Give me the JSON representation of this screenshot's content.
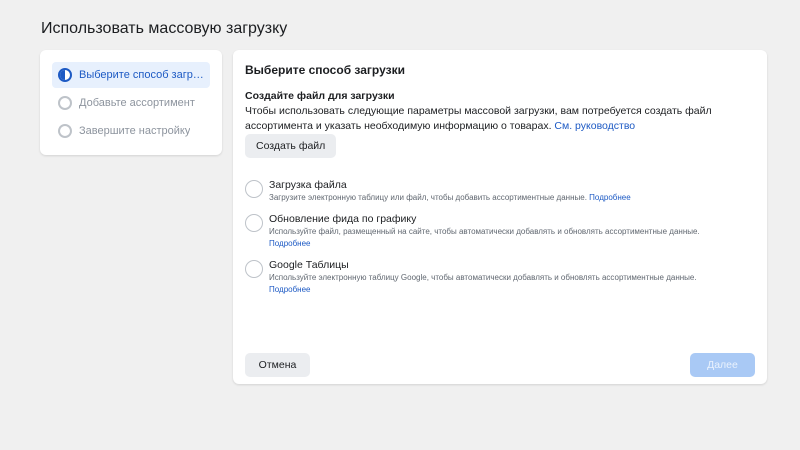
{
  "page": {
    "title": "Использовать массовую загрузку"
  },
  "steps": [
    {
      "label": "Выберите способ загрузки",
      "state": "active"
    },
    {
      "label": "Добавьте ассортимент",
      "state": "pending"
    },
    {
      "label": "Завершите настройку",
      "state": "pending"
    }
  ],
  "main": {
    "heading": "Выберите способ загрузки",
    "create_section": {
      "title": "Создайте файл для загрузки",
      "description": "Чтобы использовать следующие параметры массовой загрузки, вам потребуется создать файл ассортимента и указать необходимую информацию о товарах.",
      "link": "См. руководство",
      "button": "Создать файл"
    },
    "options": [
      {
        "title": "Загрузка файла",
        "description": "Загрузите электронную таблицу или файл, чтобы добавить ассортиментные данные.",
        "link": "Подробнее"
      },
      {
        "title": "Обновление фида по графику",
        "description": "Используйте файл, размещенный на сайте, чтобы автоматически добавлять и обновлять ассортиментные данные.",
        "link": "Подробнее"
      },
      {
        "title": "Google Таблицы",
        "description": "Используйте электронную таблицу Google, чтобы автоматически добавлять и обновлять ассортиментные данные.",
        "link": "Подробнее"
      }
    ],
    "footer": {
      "cancel": "Отмена",
      "next": "Далее"
    }
  },
  "colors": {
    "accent": "#1d5ac4",
    "next_disabled": "#a9c9f5",
    "background": "#f0f0f0"
  }
}
